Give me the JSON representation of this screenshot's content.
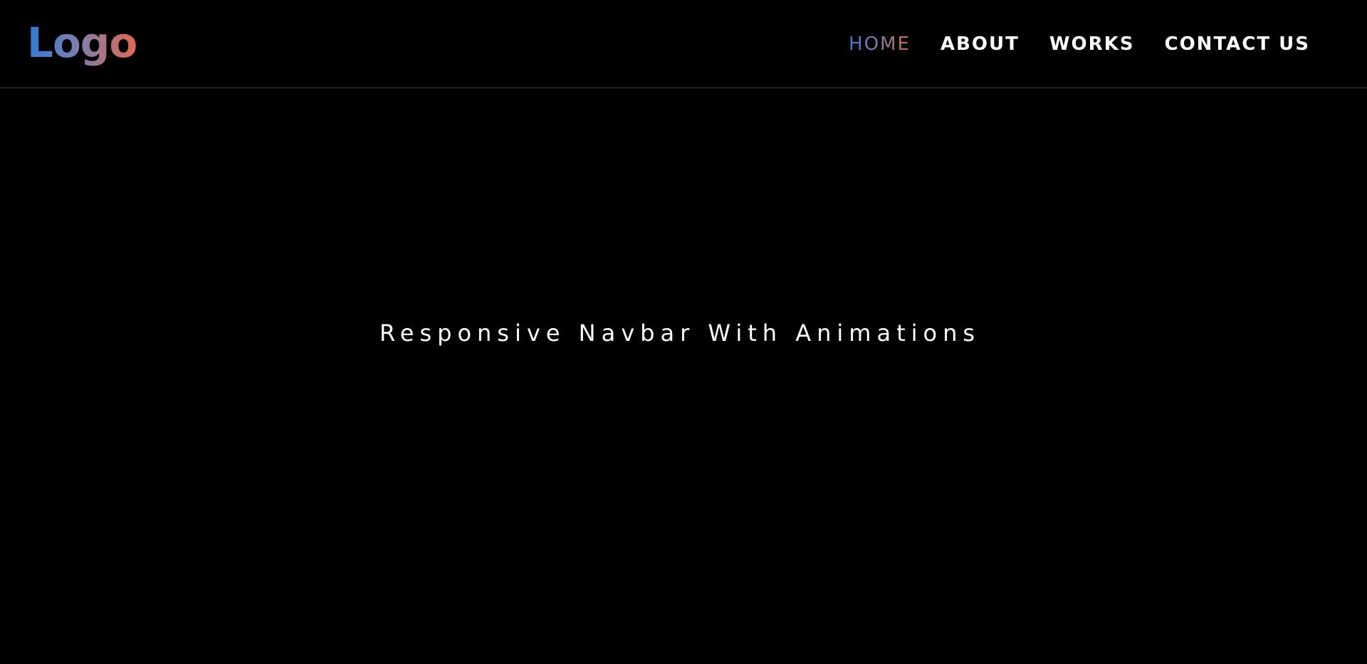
{
  "navbar": {
    "logo": "Logo",
    "links": [
      {
        "label": "HOME",
        "active": true
      },
      {
        "label": "ABOUT",
        "active": false
      },
      {
        "label": "WORKS",
        "active": false
      },
      {
        "label": "CONTACT US",
        "active": false
      }
    ]
  },
  "hero": {
    "title": "Responsive Navbar With Animations"
  },
  "colors": {
    "background": "#000000",
    "text": "#ffffff",
    "gradient_start": "#2f7bd6",
    "gradient_end": "#e2674f",
    "divider": "#3a3a3a"
  }
}
